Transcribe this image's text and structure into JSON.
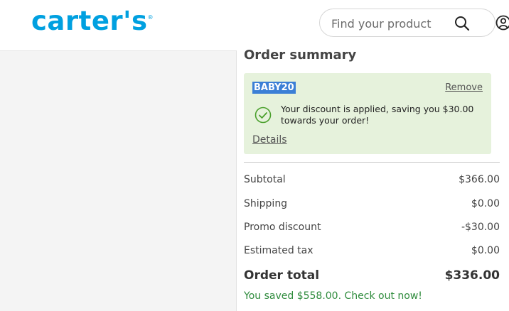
{
  "header": {
    "logo_text": "carter's",
    "logo_mark": "®",
    "search": {
      "placeholder": "Find your product",
      "icon": "search-icon"
    },
    "account_icon": "account-icon"
  },
  "summary": {
    "title": "Order summary",
    "promo": {
      "code": "BABY20",
      "remove_label": "Remove",
      "message": "Your discount is applied, saving you $30.00 towards your order!",
      "details_label": "Details",
      "icon": "check-circle-icon",
      "bg_color": "#e6f2dc"
    },
    "lines": [
      {
        "label": "Subtotal",
        "value": "$366.00"
      },
      {
        "label": "Shipping",
        "value": "$0.00"
      },
      {
        "label": "Promo discount",
        "value": "-$30.00"
      },
      {
        "label": "Estimated tax",
        "value": "$0.00"
      }
    ],
    "total": {
      "label": "Order total",
      "value": "$336.00"
    },
    "saved_message": "You saved $558.00. Check out now!"
  },
  "colors": {
    "brand": "#00a0e0",
    "success": "#2e8b3c",
    "highlight": "#3b7fd6"
  }
}
